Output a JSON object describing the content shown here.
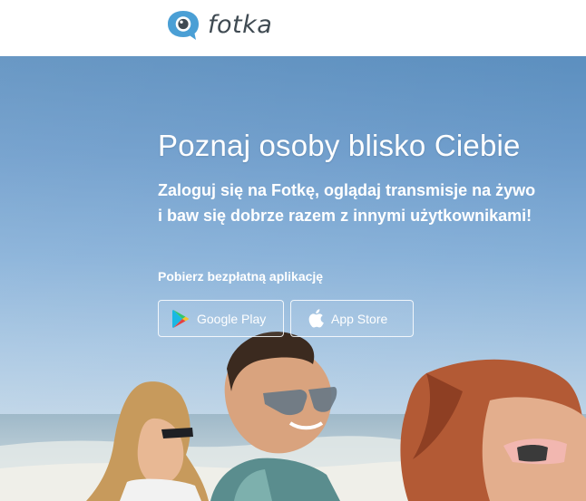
{
  "header": {
    "logo_text": "fotka",
    "logo_icon": "speech-bubble-camera-icon",
    "brand_color": "#4a9fd5"
  },
  "hero": {
    "headline": "Poznaj osoby blisko Ciebie",
    "subline_1": "Zaloguj się na Fotkę, oglądaj transmisje na żywo",
    "subline_2": "i baw się dobrze razem z innymi użytkownikami!",
    "get_app_label": "Pobierz bezpłatną aplikację",
    "google_play_label": "Google Play",
    "google_play_icon": "google-play-icon",
    "app_store_label": "App Store",
    "app_store_icon": "apple-icon",
    "background": "beach-photo-three-friends"
  }
}
